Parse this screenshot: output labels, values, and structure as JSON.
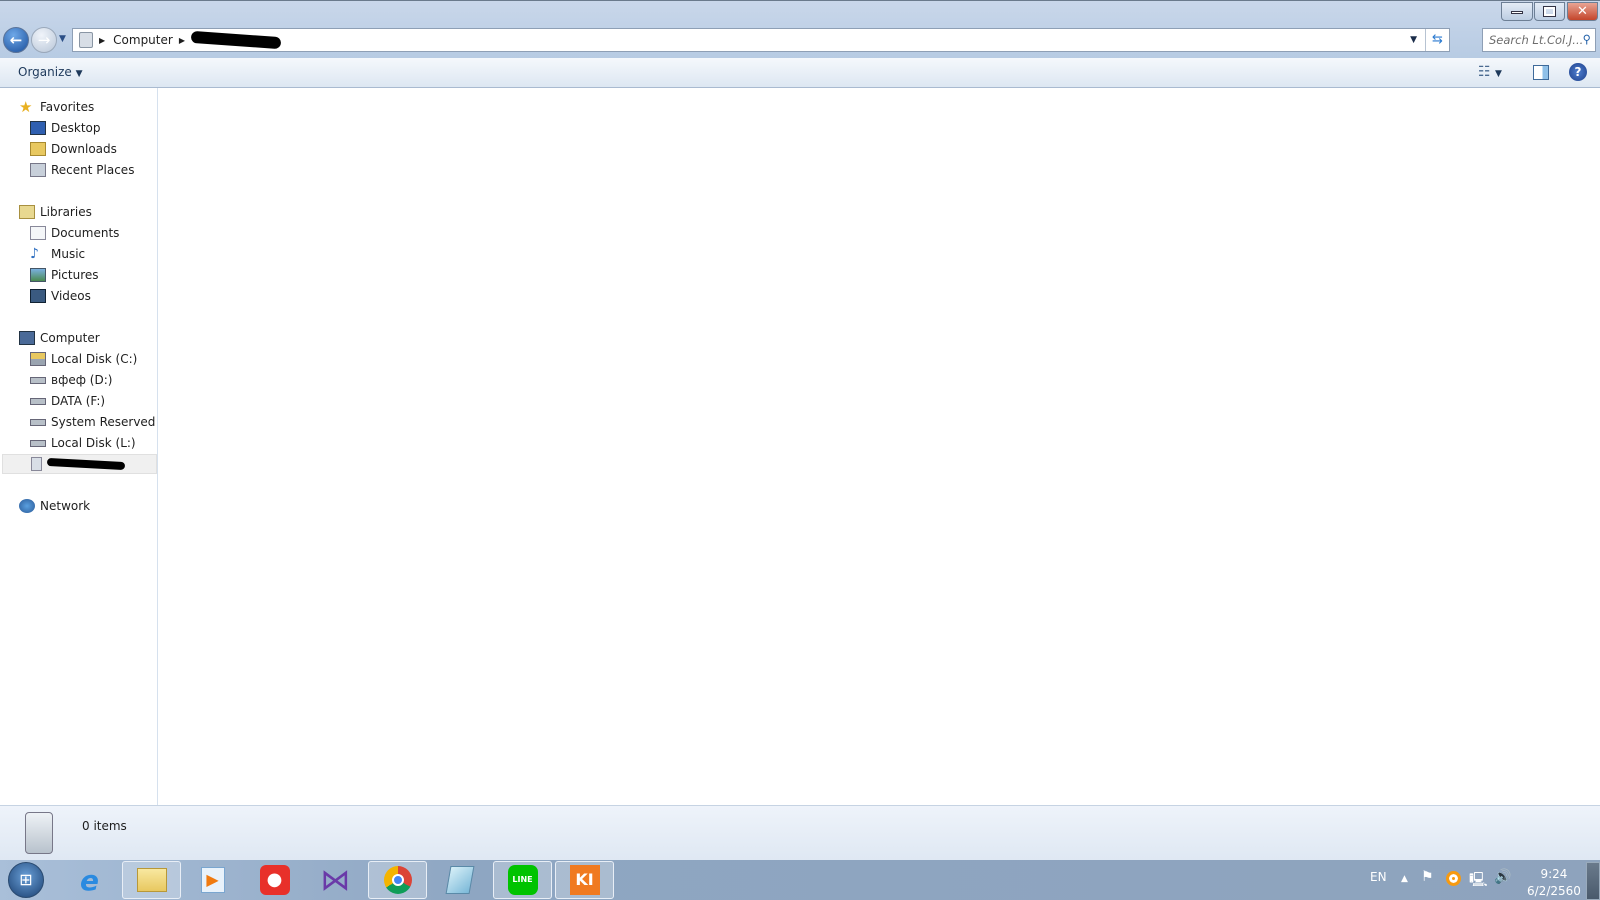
{
  "window": {
    "minimize": "minimize",
    "restore": "restore",
    "close": "close"
  },
  "address": {
    "segments": [
      "Computer"
    ],
    "redacted": true
  },
  "search": {
    "placeholder": "Search Lt.Col.J..."
  },
  "toolbar": {
    "organize": "Organize"
  },
  "sidebar": {
    "favorites": {
      "label": "Favorites",
      "items": [
        "Desktop",
        "Downloads",
        "Recent Places"
      ]
    },
    "libraries": {
      "label": "Libraries",
      "items": [
        "Documents",
        "Music",
        "Pictures",
        "Videos"
      ]
    },
    "computer": {
      "label": "Computer",
      "items": [
        "Local Disk (C:)",
        "вфеф (D:)",
        "DATA (F:)",
        "System Reserved (K:)",
        "Local Disk (L:)"
      ]
    },
    "network": {
      "label": "Network"
    }
  },
  "status": {
    "count": "0 items"
  },
  "taskbar": {
    "apps": [
      "start",
      "internet-explorer",
      "windows-explorer",
      "media-player",
      "gom-player",
      "visual-studio",
      "chrome",
      "notepad",
      "line",
      "kmplayer"
    ]
  },
  "tray": {
    "language": "EN",
    "time": "9:24",
    "date": "6/2/2560"
  },
  "colors": {
    "accent": "#1f5fa8",
    "taskbar": "#8ea6c2"
  }
}
